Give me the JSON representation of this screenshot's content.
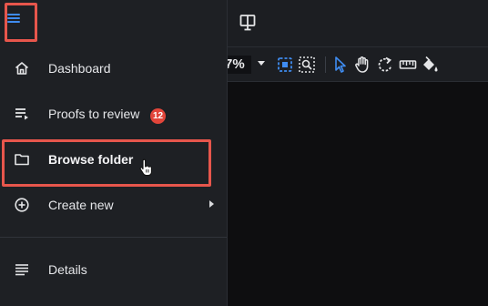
{
  "menu": {
    "items": [
      {
        "label": "Dashboard",
        "icon": "home-icon"
      },
      {
        "label": "Proofs to review",
        "icon": "playlist-icon",
        "badge": "12"
      },
      {
        "label": "Browse folder",
        "icon": "folder-icon"
      },
      {
        "label": "Create new",
        "icon": "add-circle-icon"
      },
      {
        "label": "Details",
        "icon": "details-icon"
      }
    ]
  },
  "toolbar": {
    "zoom_value": "7%",
    "tools": [
      "fit-page-icon",
      "zoom-select-icon",
      "select-arrow-icon",
      "hand-pan-icon",
      "rotate-icon",
      "ruler-icon",
      "paint-bucket-icon"
    ]
  },
  "colors": {
    "accent_blue": "#3f8cf0",
    "highlight_red": "#e7564c",
    "badge_red": "#e2453a",
    "menu_bg": "#1e2024"
  }
}
